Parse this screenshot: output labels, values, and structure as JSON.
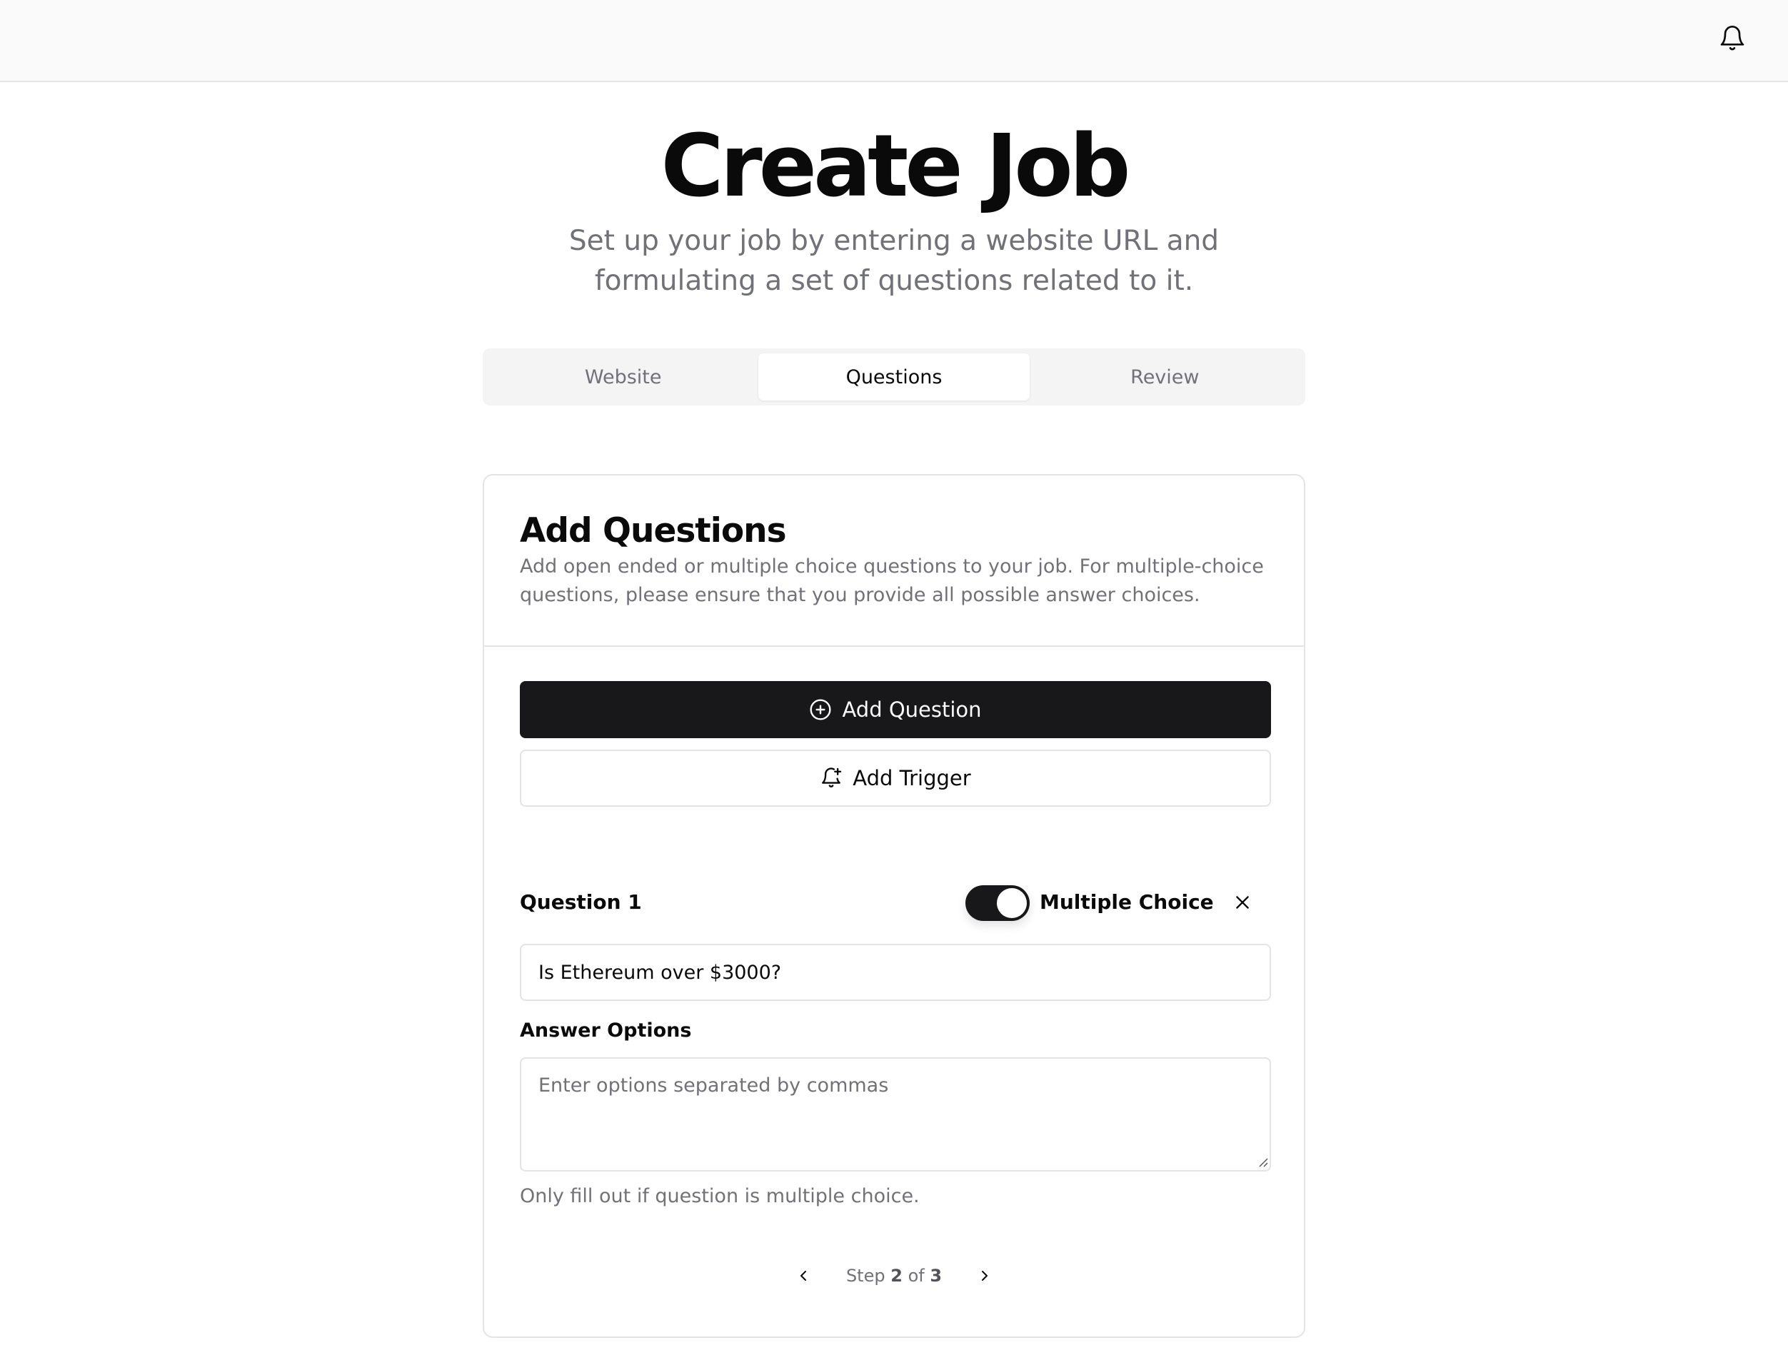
{
  "header": {
    "notifications_icon": "bell-icon"
  },
  "page": {
    "title": "Create Job",
    "subtitle": "Set up your job by entering a website URL and formulating a set of questions related to it."
  },
  "tabs": [
    {
      "label": "Website",
      "active": false
    },
    {
      "label": "Questions",
      "active": true
    },
    {
      "label": "Review",
      "active": false
    }
  ],
  "card": {
    "title": "Add Questions",
    "description": "Add open ended or multiple choice questions to your job. For multiple-choice questions, please ensure that you provide all possible answer choices.",
    "add_question_label": "Add Question",
    "add_trigger_label": "Add Trigger"
  },
  "question": {
    "label": "Question 1",
    "multiple_choice_label": "Multiple Choice",
    "multiple_choice_on": true,
    "value": "Is Ethereum over $3000?",
    "answers_label": "Answer Options",
    "answers_placeholder": "Enter options separated by commas",
    "answers_value": "",
    "helper": "Only fill out if question is multiple choice."
  },
  "stepper": {
    "prefix": "Step",
    "current": "2",
    "middle": "of",
    "total": "3"
  },
  "colors": {
    "primary": "#18181b",
    "muted": "#71717a",
    "border": "#e4e4e7"
  }
}
